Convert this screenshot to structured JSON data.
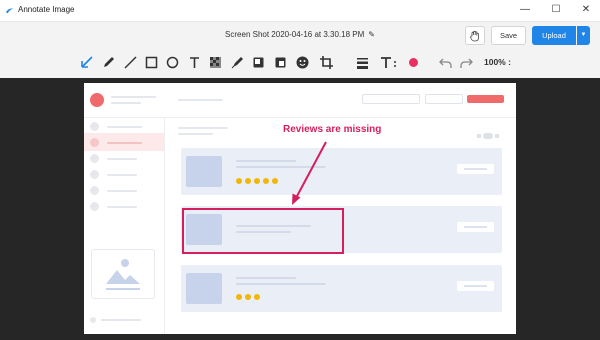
{
  "window": {
    "title": "Annotate Image",
    "minimize_glyph": "—",
    "maximize_glyph": "☐",
    "close_glyph": "✕"
  },
  "header": {
    "filename": "Screen Shot 2020-04-16 at 3.30.18 PM",
    "save_label": "Save",
    "upload_label": "Upload"
  },
  "toolbar": {
    "tools": [
      "arrow-tool",
      "pen-tool",
      "line-tool",
      "rectangle-tool",
      "ellipse-tool",
      "text-tool",
      "pixelate-tool",
      "highlighter-tool",
      "fill-tool",
      "emoji-tool",
      "crop-tool",
      "line-weight-tool",
      "font-size-tool",
      "color-picker",
      "undo",
      "redo"
    ],
    "zoom": "100%"
  },
  "colors": {
    "accent": "#1f86e8",
    "annotation": "#d41f5f",
    "selected_color": "#e8305e"
  },
  "annotation": {
    "text": "Reviews are missing"
  }
}
